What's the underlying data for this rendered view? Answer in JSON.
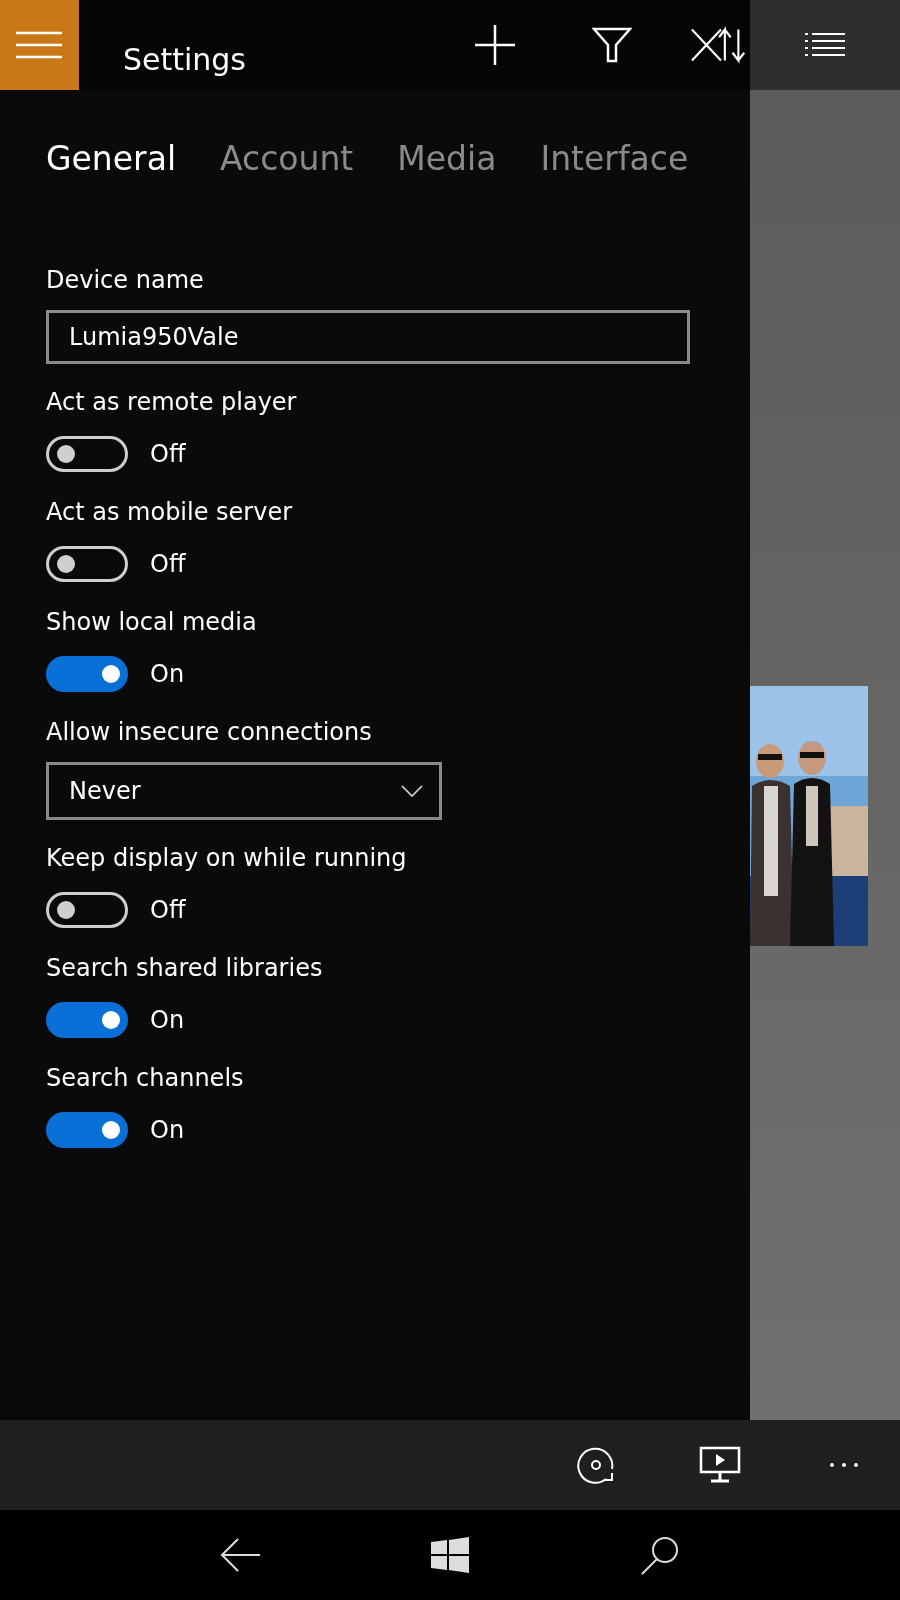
{
  "top_bar": {
    "title": "Settings"
  },
  "tabs": [
    {
      "label": "General",
      "selected": true
    },
    {
      "label": "Account",
      "selected": false
    },
    {
      "label": "Media",
      "selected": false
    },
    {
      "label": "Interface",
      "selected": false
    }
  ],
  "settings": [
    {
      "kind": "text",
      "label": "Device name",
      "value": "Lumia950Vale"
    },
    {
      "kind": "toggle",
      "label": "Act as remote player",
      "on": false,
      "state_text": "Off"
    },
    {
      "kind": "toggle",
      "label": "Act as mobile server",
      "on": false,
      "state_text": "Off"
    },
    {
      "kind": "toggle",
      "label": "Show local media",
      "on": true,
      "state_text": "On"
    },
    {
      "kind": "dropdown",
      "label": "Allow insecure connections",
      "value": "Never"
    },
    {
      "kind": "toggle",
      "label": "Keep display on while running",
      "on": false,
      "state_text": "Off"
    },
    {
      "kind": "toggle",
      "label": "Search shared libraries",
      "on": true,
      "state_text": "On"
    },
    {
      "kind": "toggle",
      "label": "Search channels",
      "on": true,
      "state_text": "On"
    }
  ]
}
